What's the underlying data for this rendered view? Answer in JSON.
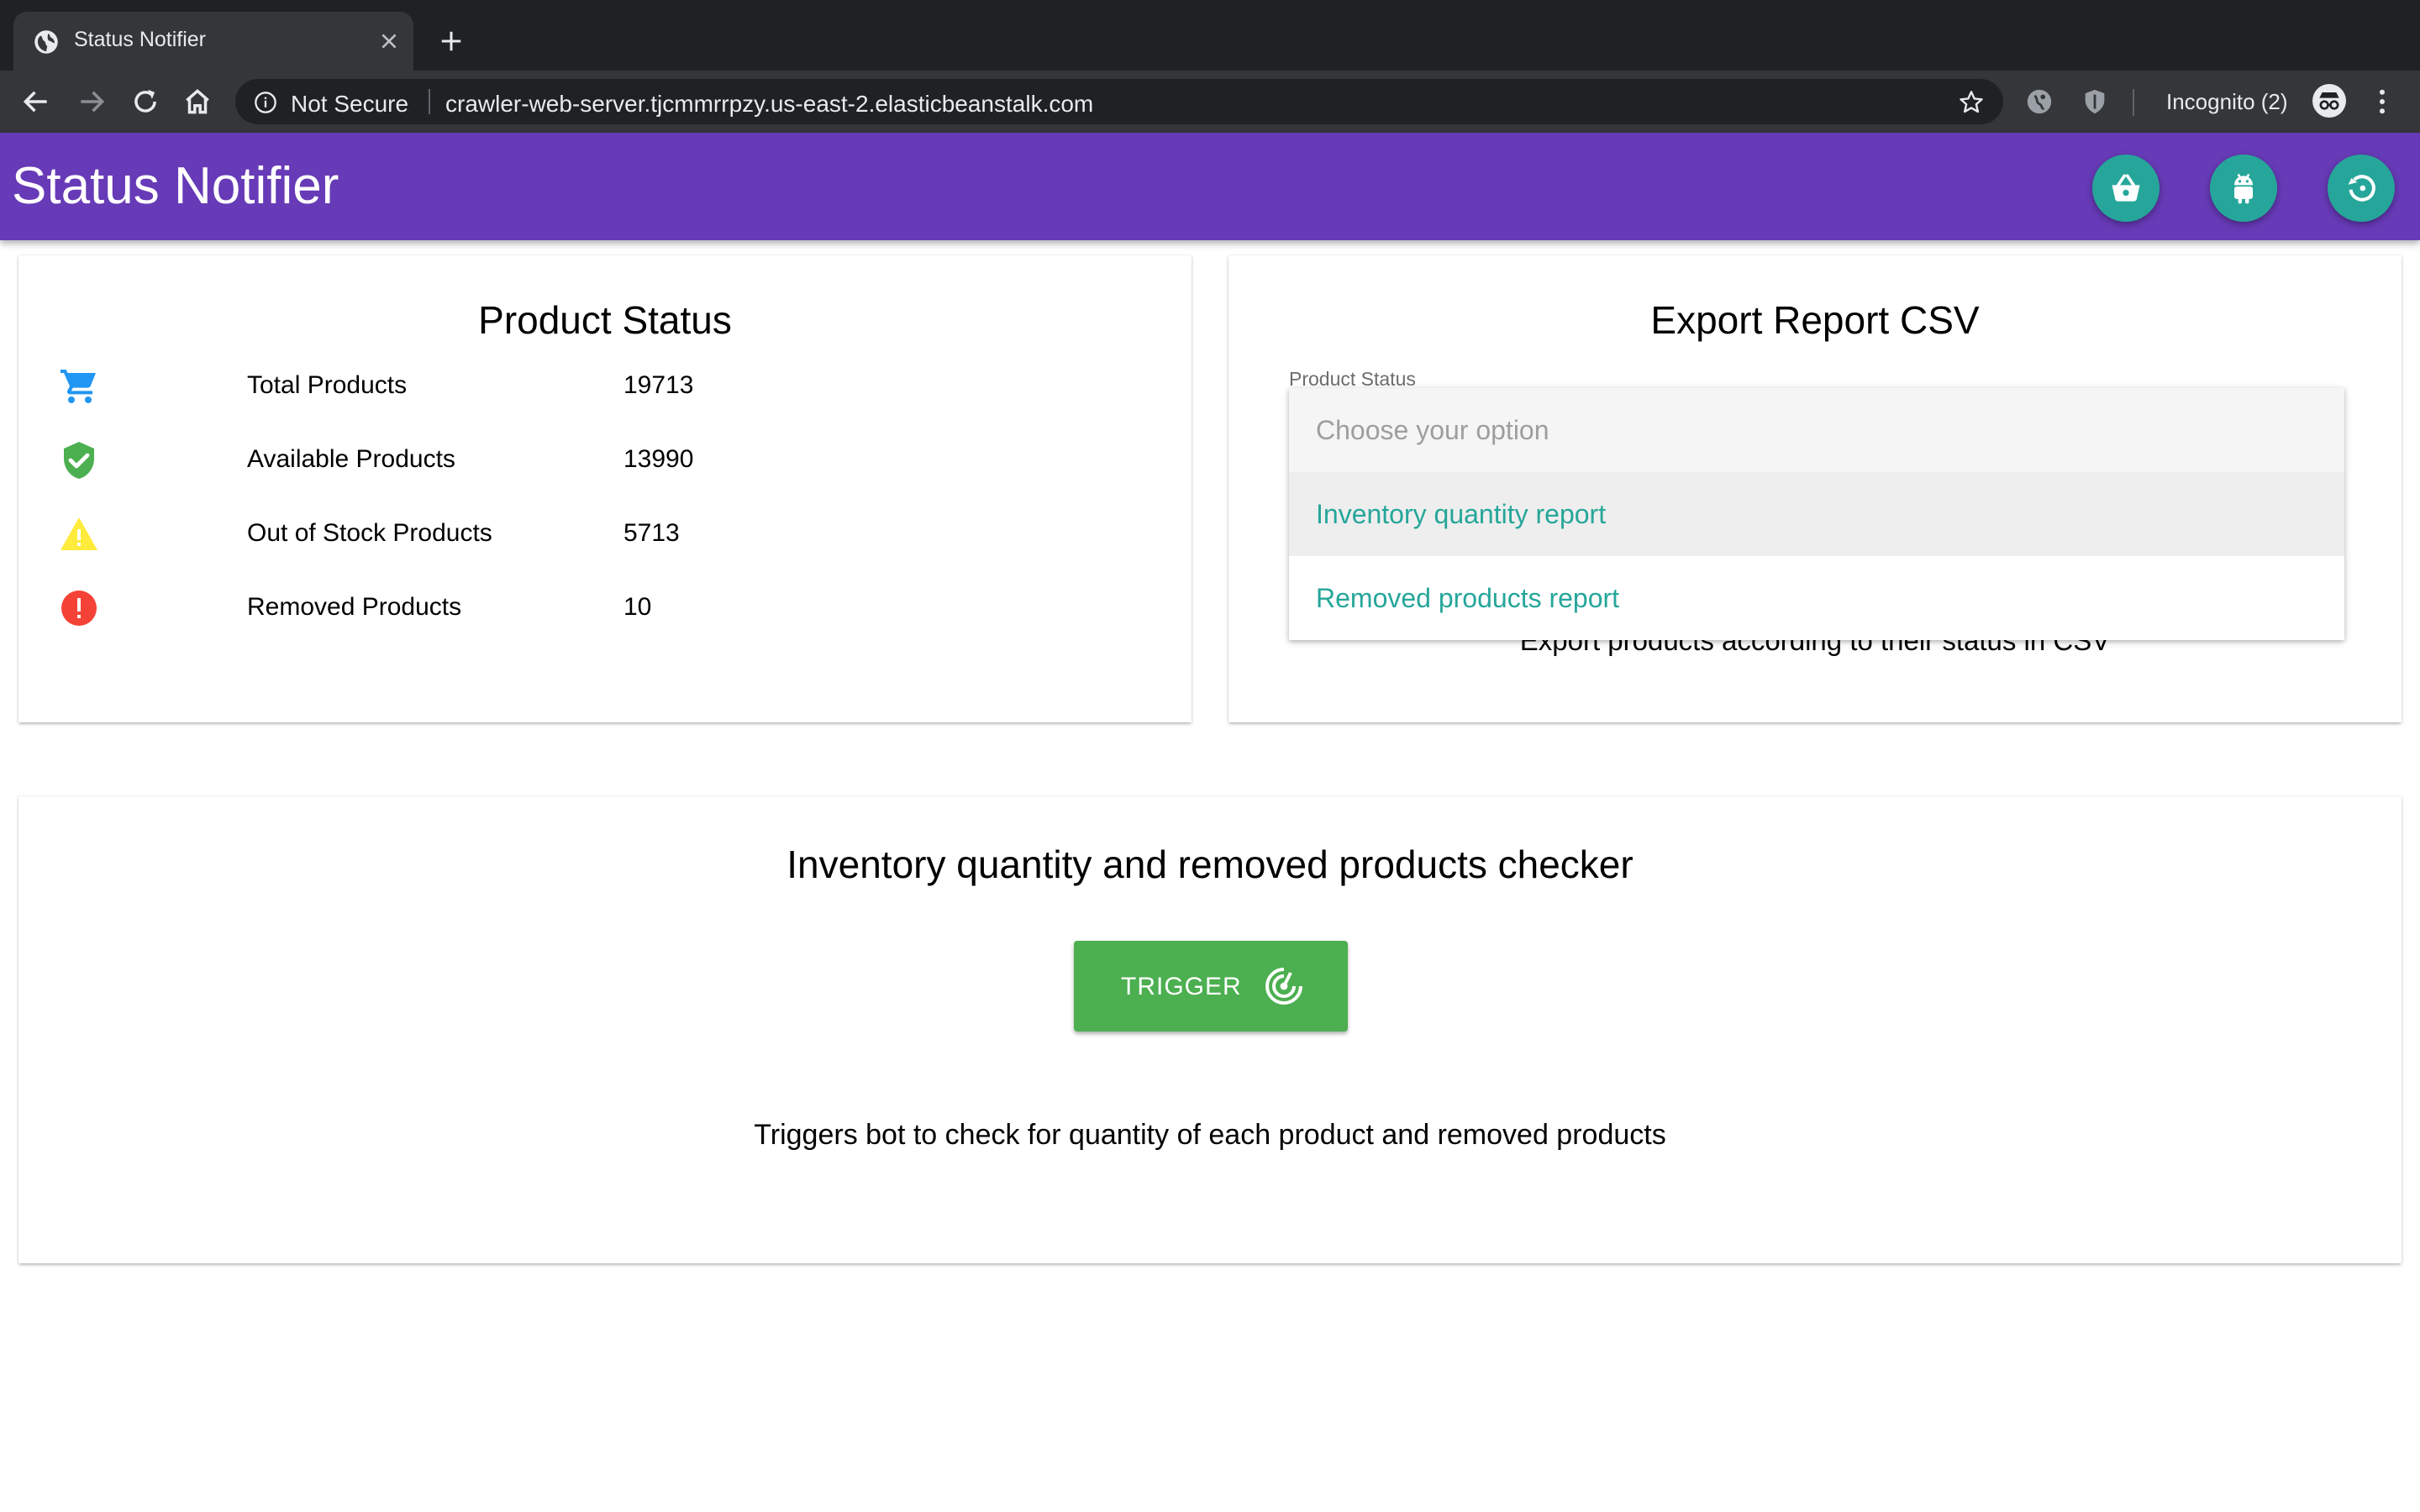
{
  "browser": {
    "tab_title": "Status Notifier",
    "security_label": "Not Secure",
    "url": "crawler-web-server.tjcmmrrpzy.us-east-2.elasticbeanstalk.com",
    "profile_label": "Incognito (2)"
  },
  "appbar": {
    "title": "Status Notifier",
    "actions": [
      "basket-icon",
      "android-icon",
      "restore-icon"
    ],
    "color": "#673ab7",
    "fab_color": "#26a69a"
  },
  "product_status": {
    "title": "Product Status",
    "rows": [
      {
        "icon": "cart-icon",
        "label": "Total Products",
        "value": "19713",
        "color": "#2196f3"
      },
      {
        "icon": "verified-shield-icon",
        "label": "Available Products",
        "value": "13990",
        "color": "#4caf50"
      },
      {
        "icon": "warning-icon",
        "label": "Out of Stock Products",
        "value": "5713",
        "color": "#ffeb3b"
      },
      {
        "icon": "error-icon",
        "label": "Removed Products",
        "value": "10",
        "color": "#f44336"
      }
    ]
  },
  "export_report": {
    "title": "Export Report CSV",
    "field_label": "Product Status",
    "placeholder": "Choose your option",
    "options": [
      "Inventory quantity report",
      "Removed products report"
    ],
    "highlighted_option": "Inventory quantity report",
    "description": "Export products according to their status in CSV",
    "option_color": "#26a69a"
  },
  "checker": {
    "title": "Inventory quantity and removed products checker",
    "button_label": "TRIGGER",
    "button_color": "#4caf50",
    "description": "Triggers bot to check for quantity of each product and removed products"
  }
}
